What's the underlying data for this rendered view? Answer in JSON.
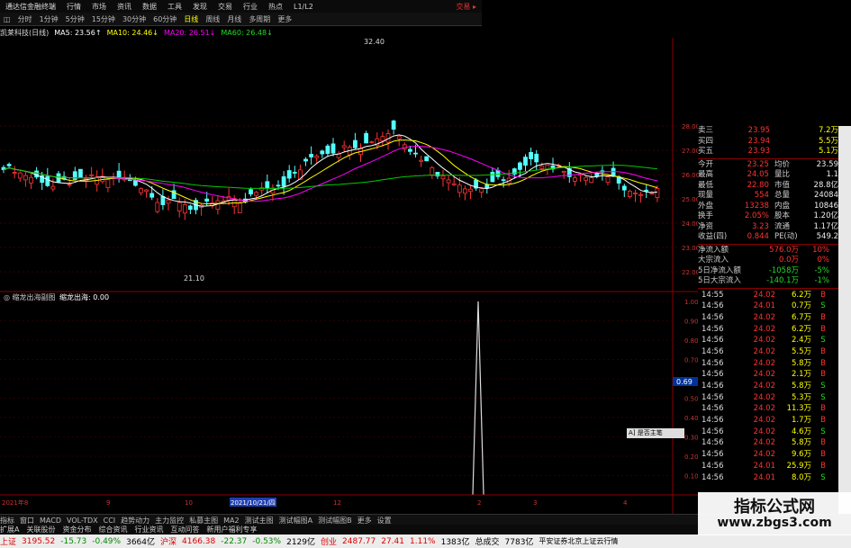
{
  "titlebar": {
    "app_name": "通达信金融终端",
    "menus": [
      "行情",
      "市场",
      "资讯",
      "数据",
      "工具",
      "发现",
      "交易",
      "行业",
      "热点",
      "L1/L2"
    ],
    "trade": "交易 ▸"
  },
  "periodbar": {
    "prefix": "◫",
    "items": [
      "分时",
      "1分钟",
      "5分钟",
      "15分钟",
      "30分钟",
      "60分钟",
      "日线",
      "周线",
      "月线",
      "多周期",
      "更多"
    ],
    "selected": "日线"
  },
  "ma_legend": {
    "stock": "凯莱科技(日线)",
    "ma5": "MA5: 23.56↑",
    "ma10": "MA10: 24.46↓",
    "ma20": "MA20: 26.51↓",
    "ma60": "MA60: 26.48↓"
  },
  "colors": {
    "ma5": "#ffffff",
    "ma10": "#ffff00",
    "ma20": "#ff00ff",
    "ma60": "#00cc00",
    "up": "#ff3333",
    "down": "#54ffff",
    "grid": "#8b0000"
  },
  "main_chart": {
    "high_label": "32.40",
    "low_label": "21.10",
    "price_axis": [
      "28.00",
      "27.00",
      "26.00",
      "25.00",
      "24.00",
      "23.00",
      "22.00"
    ]
  },
  "sub_chart": {
    "title": "◎ 缩龙出海副图",
    "name": "缩龙出海: 0.00",
    "axis": [
      "1.00",
      "0.90",
      "0.80",
      "0.70",
      "0.60",
      "0.50",
      "0.40",
      "0.30",
      "0.20",
      "0.10"
    ],
    "marker": "0.69"
  },
  "date_axis": {
    "labels": [
      "2021年8",
      "9",
      "10",
      "2021/10/21/四",
      "12",
      "2",
      "3",
      "4"
    ]
  },
  "quote_panel": {
    "asks": [
      {
        "label": "卖三",
        "price": "23.95",
        "vol": "7.2万"
      },
      {
        "label": "买四",
        "price": "23.94",
        "vol": "5.5万"
      },
      {
        "label": "买五",
        "price": "23.93",
        "vol": "5.1万"
      }
    ],
    "stats": [
      {
        "l": "今开",
        "v": "23.25",
        "l2": "均价",
        "v2": "23.59"
      },
      {
        "l": "最高",
        "v": "24.05",
        "l2": "量比",
        "v2": "1.1"
      },
      {
        "l": "最低",
        "v": "22.80",
        "l2": "市值",
        "v2": "28.8亿"
      },
      {
        "l": "现量",
        "v": "554",
        "l2": "总量",
        "v2": "24084"
      },
      {
        "l": "外盘",
        "v": "13238",
        "l2": "内盘",
        "v2": "10846"
      },
      {
        "l": "换手",
        "v": "2.05%",
        "l2": "股本",
        "v2": "1.20亿"
      },
      {
        "l": "净资",
        "v": "3.23",
        "l2": "流通",
        "v2": "1.17亿"
      },
      {
        "l": "收益(四)",
        "v": "0.844",
        "l2": "PE(动)",
        "v2": "549.2"
      }
    ],
    "flows": [
      {
        "l": "净流入额",
        "v": "576.0万",
        "p": "10%"
      },
      {
        "l": "大宗流入",
        "v": "0.0万",
        "p": "0%"
      },
      {
        "l": "5日净流入额",
        "v": "-1058万",
        "p": "-5%"
      },
      {
        "l": "5日大宗流入",
        "v": "-140.1万",
        "p": "-1%"
      }
    ],
    "trades": [
      {
        "t": "14:55",
        "p": "24.02",
        "q": "6.2万",
        "s": "B"
      },
      {
        "t": "14:56",
        "p": "24.01",
        "q": "0.7万",
        "s": "S"
      },
      {
        "t": "14:56",
        "p": "24.02",
        "q": "6.7万",
        "s": "B"
      },
      {
        "t": "14:56",
        "p": "24.02",
        "q": "6.2万",
        "s": "B"
      },
      {
        "t": "14:56",
        "p": "24.02",
        "q": "2.4万",
        "s": "S"
      },
      {
        "t": "14:56",
        "p": "24.02",
        "q": "5.5万",
        "s": "B"
      },
      {
        "t": "14:56",
        "p": "24.02",
        "q": "5.8万",
        "s": "B"
      },
      {
        "t": "14:56",
        "p": "24.02",
        "q": "2.1万",
        "s": "B"
      },
      {
        "t": "14:56",
        "p": "24.02",
        "q": "5.8万",
        "s": "S"
      },
      {
        "t": "14:56",
        "p": "24.02",
        "q": "5.3万",
        "s": "S"
      },
      {
        "t": "14:56",
        "p": "24.02",
        "q": "11.3万",
        "s": "B"
      },
      {
        "t": "14:56",
        "p": "24.02",
        "q": "1.7万",
        "s": "B"
      },
      {
        "t": "14:56",
        "p": "24.02",
        "q": "4.6万",
        "s": "S"
      },
      {
        "t": "14:56",
        "p": "24.02",
        "q": "5.8万",
        "s": "B"
      },
      {
        "t": "14:56",
        "p": "24.02",
        "q": "9.6万",
        "s": "B"
      },
      {
        "t": "14:56",
        "p": "24.01",
        "q": "25.9万",
        "s": "B"
      },
      {
        "t": "14:56",
        "p": "24.01",
        "q": "8.0万",
        "s": "S"
      }
    ]
  },
  "bottom_tabs": [
    "指标",
    "窗口",
    "MACD",
    "VOL-TDX",
    "CCI",
    "趋势动力",
    "主力监控",
    "私募主图",
    "MA2",
    "测试主图",
    "测试幅图A",
    "测试幅图B",
    "更多",
    "设置"
  ],
  "bottom_tabs2": [
    "扩展A",
    "关联股份",
    "资金分布",
    "综合资讯",
    "行业资讯",
    "互动问答",
    "新用户福利专享"
  ],
  "statusbar": {
    "sh_label": "上证",
    "sh_val": "3195.52",
    "sh_chg": "-15.73",
    "sh_pct": "-0.49%",
    "sh_amt": "3664亿",
    "hs_label": "沪深",
    "hs_val": "4166.38",
    "hs_chg": "-22.37",
    "hs_pct": "-0.53%",
    "hs_amt": "2129亿",
    "cy_label": "创业",
    "cy_val": "2487.77",
    "cy_chg": "27.41",
    "cy_pct": "1.11%",
    "cy_amt": "1383亿",
    "total_label": "总成交",
    "total_val": "7783亿",
    "tail": "平安证券北京上证云行情"
  },
  "popup": {
    "text": "A] 是否主笔 [-]·□×"
  },
  "watermark": {
    "line1": "指标公式网",
    "line2": "www.zbgs3.com"
  }
}
